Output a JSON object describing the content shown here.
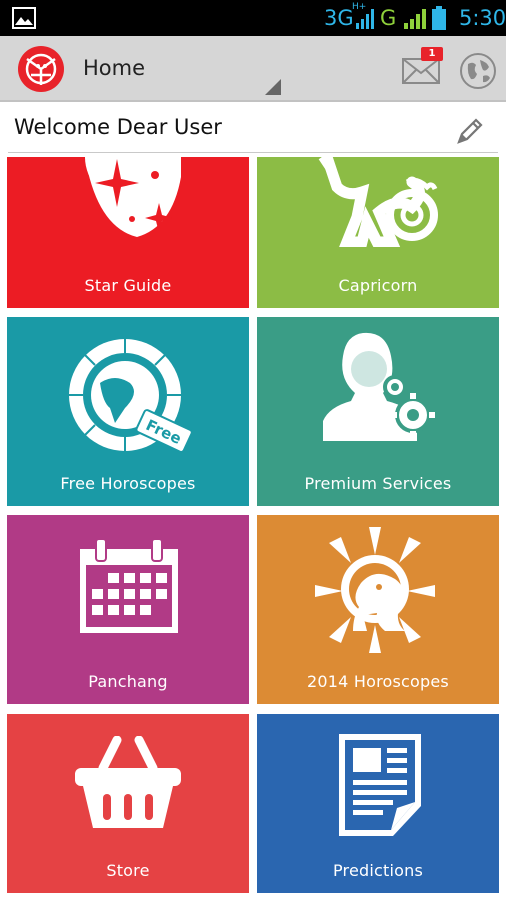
{
  "status_bar": {
    "network_1": "3G",
    "network_1_sup": "H+",
    "network_2": "G",
    "time": "5:30"
  },
  "app_bar": {
    "title": "Home",
    "notification_count": "1"
  },
  "welcome": {
    "text": "Welcome Dear User"
  },
  "tiles": [
    {
      "label": "Star Guide",
      "color": "#ec1c24",
      "icon": "zodiac-stars-icon"
    },
    {
      "label": "Capricorn",
      "color": "#8cbc45",
      "icon": "capricorn-icon"
    },
    {
      "label": "Free Horoscopes",
      "color": "#1a9aa6",
      "icon": "zodiac-wheel-free-icon"
    },
    {
      "label": "Premium Services",
      "color": "#3a9d86",
      "icon": "user-gears-icon"
    },
    {
      "label": "Panchang",
      "color": "#b13a86",
      "icon": "calendar-icon"
    },
    {
      "label": "2014 Horoscopes",
      "color": "#dc8b34",
      "icon": "leo-sun-icon"
    },
    {
      "label": "Store",
      "color": "#e54244",
      "icon": "basket-icon"
    },
    {
      "label": "Predictions",
      "color": "#2a66b0",
      "icon": "document-icon"
    }
  ]
}
